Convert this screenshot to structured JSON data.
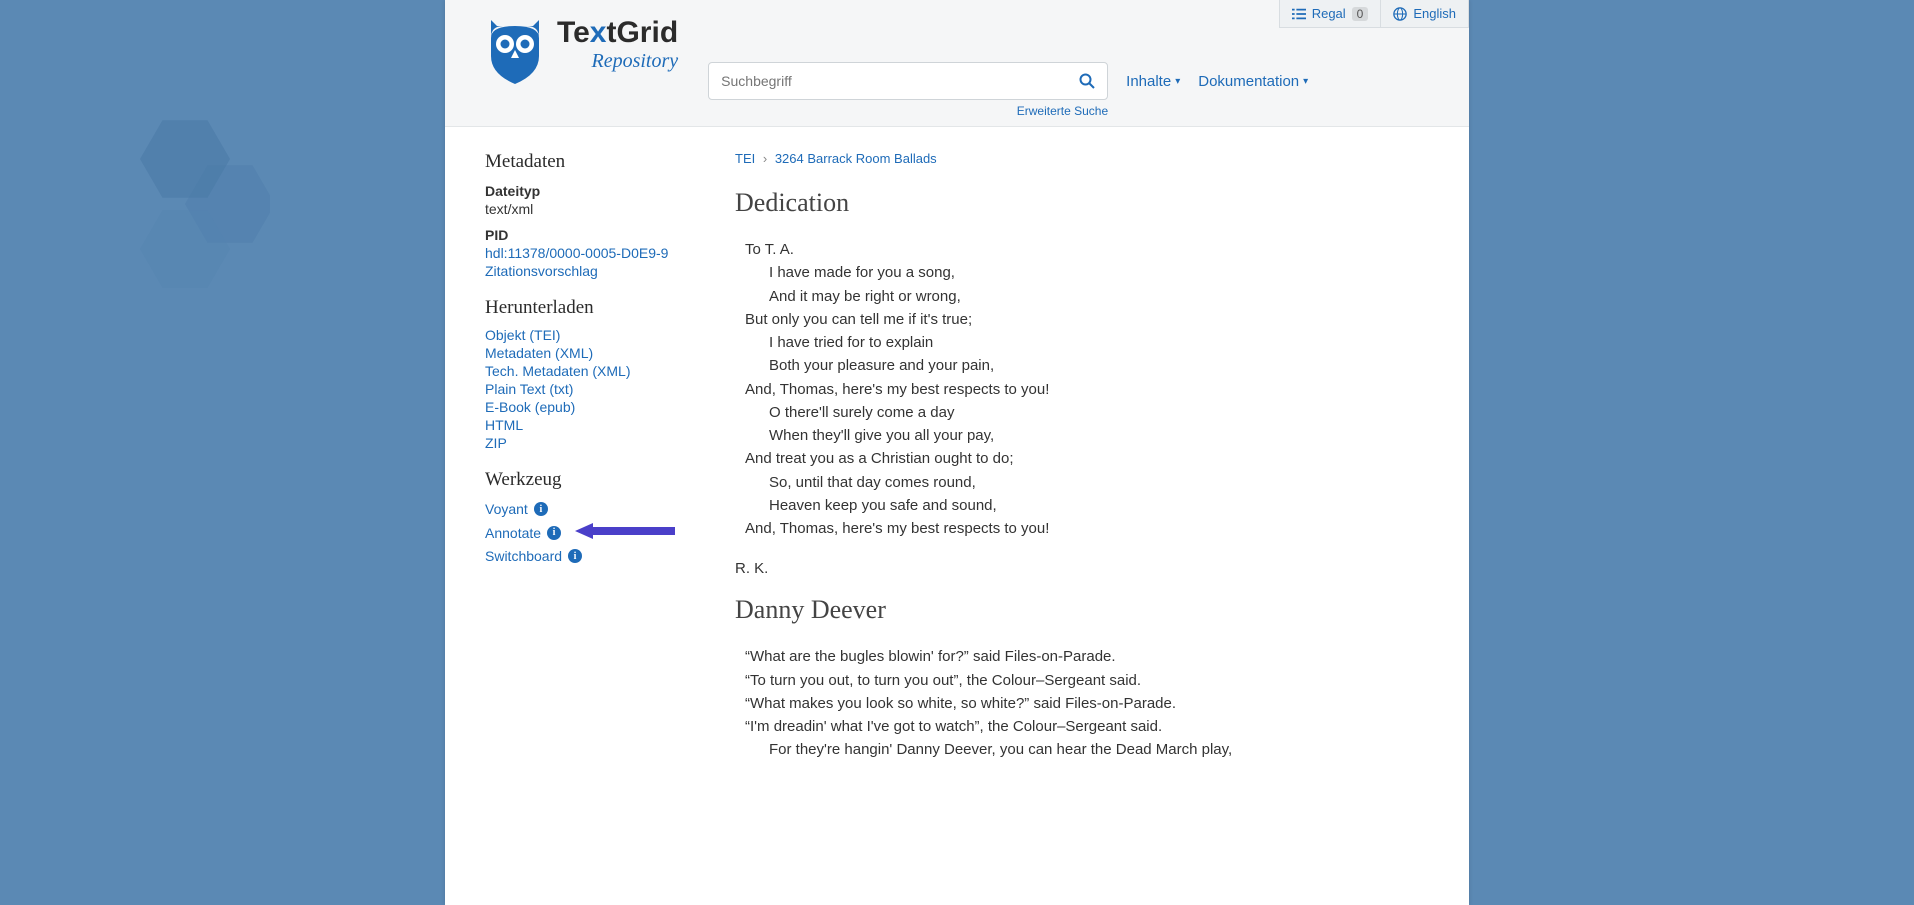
{
  "top": {
    "shelf_label": "Regal",
    "shelf_count": "0",
    "lang_label": "English"
  },
  "logo": {
    "t1": "Te",
    "tx": "x",
    "t2": "tGrid",
    "sub": "Repository"
  },
  "search": {
    "placeholder": "Suchbegriff",
    "advanced": "Erweiterte Suche"
  },
  "nav": {
    "contents": "Inhalte",
    "docs": "Dokumentation"
  },
  "sidebar": {
    "metadata_h": "Metadaten",
    "filetype_label": "Dateityp",
    "filetype_value": "text/xml",
    "pid_label": "PID",
    "pid_link": "hdl:11378/0000-0005-D0E9-9",
    "citation_link": "Zitationsvorschlag",
    "download_h": "Herunterladen",
    "dl": [
      "Objekt (TEI)",
      "Metadaten (XML)",
      "Tech. Metadaten (XML)",
      "Plain Text (txt)",
      "E-Book (epub)",
      "HTML",
      "ZIP"
    ],
    "tools_h": "Werkzeug",
    "tools": [
      "Voyant",
      "Annotate",
      "Switchboard"
    ]
  },
  "breadcrumb": {
    "a": "TEI",
    "b": "3264 Barrack Room Ballads"
  },
  "content": {
    "h1": "Dedication",
    "poem1": [
      {
        "i": 0,
        "t": "To T. A."
      },
      {
        "i": 1,
        "t": "I have made for you a song,"
      },
      {
        "i": 1,
        "t": "And it may be right or wrong,"
      },
      {
        "i": 0,
        "t": "But only you can tell me if it's true;"
      },
      {
        "i": 1,
        "t": "I have tried for to explain"
      },
      {
        "i": 1,
        "t": "Both your pleasure and your pain,"
      },
      {
        "i": 0,
        "t": "And, Thomas, here's my best respects to you!"
      },
      {
        "i": 1,
        "t": "O there'll surely come a day"
      },
      {
        "i": 1,
        "t": "When they'll give you all your pay,"
      },
      {
        "i": 0,
        "t": "And treat you as a Christian ought to do;"
      },
      {
        "i": 1,
        "t": "So, until that day comes round,"
      },
      {
        "i": 1,
        "t": "Heaven keep you safe and sound,"
      },
      {
        "i": 0,
        "t": "And, Thomas, here's my best respects to you!"
      }
    ],
    "signature": "R. K.",
    "h2": "Danny Deever",
    "poem2": [
      {
        "i": 0,
        "t": "“What are the bugles blowin' for?” said Files-on-Parade."
      },
      {
        "i": 0,
        "t": "“To turn you out, to turn you out”, the Colour–Sergeant said."
      },
      {
        "i": 0,
        "t": "“What makes you look so white, so white?” said Files-on-Parade."
      },
      {
        "i": 0,
        "t": "“I'm dreadin' what I've got to watch”, the Colour–Sergeant said."
      },
      {
        "i": 2,
        "t": "For they're hangin' Danny Deever, you can hear the Dead March play,"
      }
    ]
  }
}
